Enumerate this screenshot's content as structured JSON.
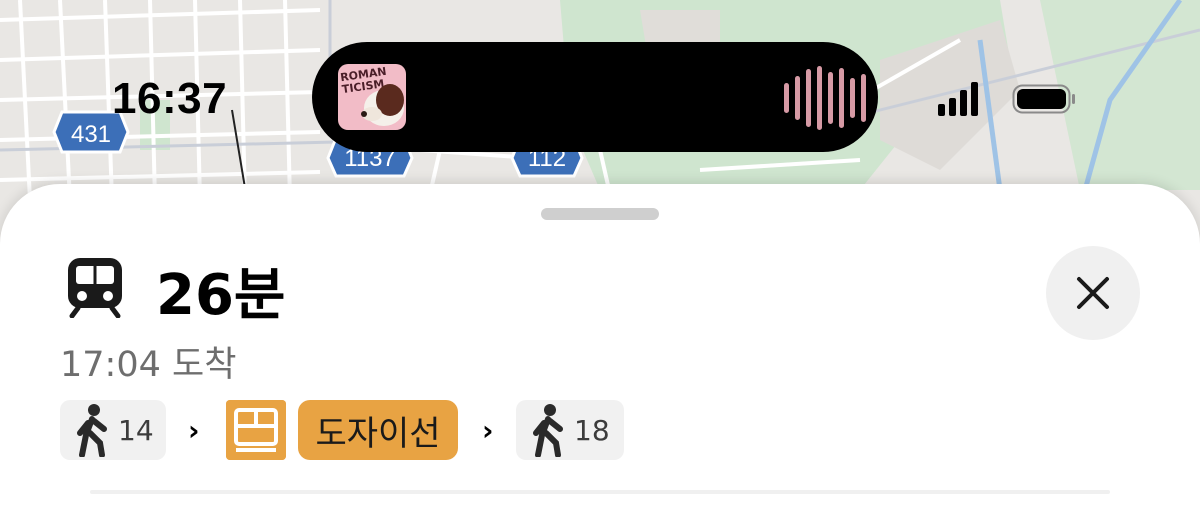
{
  "status_bar": {
    "time": "16:37"
  },
  "now_playing": {
    "album_art_text": "ROMAN\nTICISM",
    "waveform_color": "#d69aa5",
    "album_color": "#f2bcc7"
  },
  "map": {
    "route_badges": [
      "431",
      "1137",
      "112"
    ]
  },
  "route_sheet": {
    "mode_icon": "train-icon",
    "duration": "26분",
    "arrival": "17:04 도착",
    "close_icon": "close-icon",
    "steps": [
      {
        "type": "walk",
        "icon": "walking-person-icon",
        "minutes": "14"
      },
      {
        "type": "transit",
        "icon": "tram-icon",
        "line_name": "도자이선",
        "color": "#e8a343"
      },
      {
        "type": "walk",
        "icon": "walking-person-icon",
        "minutes": "18"
      }
    ],
    "chevron": "›"
  }
}
